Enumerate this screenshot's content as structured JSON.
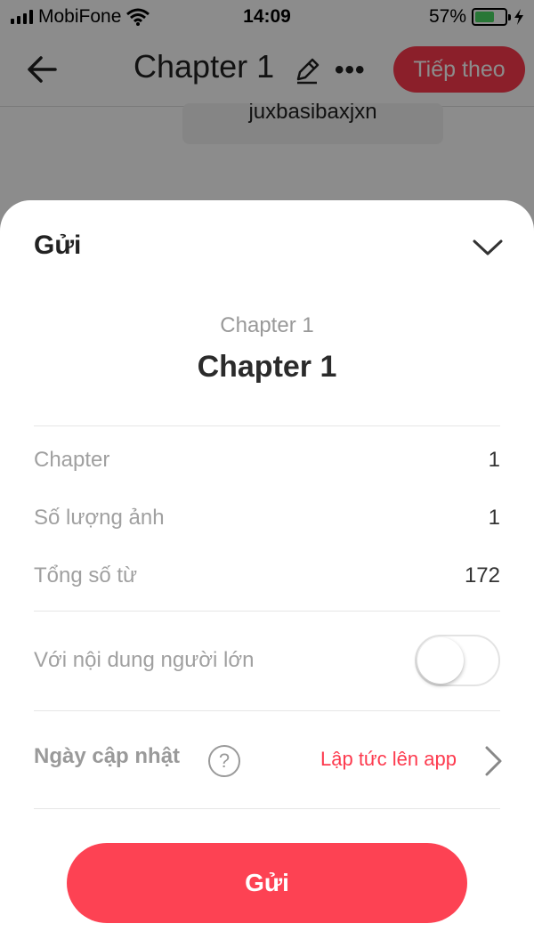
{
  "status_bar": {
    "carrier": "MobiFone",
    "time": "14:09",
    "battery_percent": "57%"
  },
  "nav": {
    "title": "Chapter 1",
    "next_label": "Tiếp theo"
  },
  "background_card": {
    "text": "juxbasibaxjxn"
  },
  "sheet": {
    "title": "Gửi",
    "chapter_subtitle": "Chapter 1",
    "chapter_title": "Chapter 1",
    "rows": [
      {
        "label": "Chapter",
        "value": "1"
      },
      {
        "label": "Số lượng ảnh",
        "value": "1"
      },
      {
        "label": "Tổng số từ",
        "value": "172"
      }
    ],
    "adult_content": {
      "label": "Với nội dung người lớn",
      "enabled": false
    },
    "update_date": {
      "label": "Ngày cập nhật",
      "help": "?",
      "value": "Lập tức lên app"
    },
    "send_label": "Gửi"
  },
  "colors": {
    "accent": "#fd4253",
    "battery": "#4cd964"
  },
  "icons": [
    "back-arrow-icon",
    "edit-pencil-icon",
    "more-icon",
    "chevron-down-icon",
    "help-icon",
    "chevron-right-icon",
    "wifi-icon",
    "signal-icon",
    "battery-icon",
    "charging-icon"
  ]
}
